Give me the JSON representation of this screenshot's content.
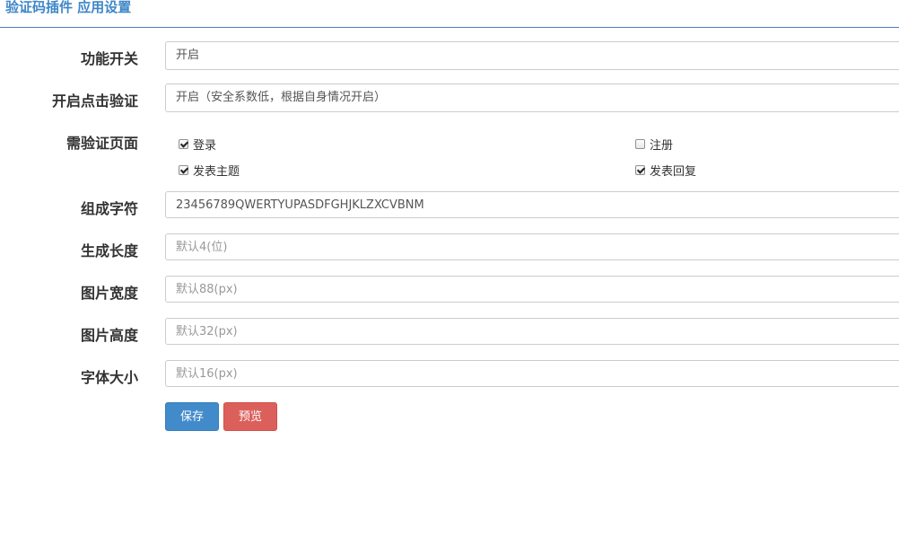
{
  "header": {
    "title": "验证码插件 应用设置"
  },
  "form": {
    "enable": {
      "label": "功能开关",
      "value": "开启"
    },
    "click_verify": {
      "label": "开启点击验证",
      "value": "开启（安全系数低，根据自身情况开启）"
    },
    "pages": {
      "label": "需验证页面",
      "options": [
        {
          "label": "登录",
          "checked": true
        },
        {
          "label": "注册",
          "checked": false
        },
        {
          "label": "发表主题",
          "checked": true
        },
        {
          "label": "发表回复",
          "checked": true
        }
      ]
    },
    "charset": {
      "label": "组成字符",
      "value": "23456789QWERTYUPASDFGHJKLZXCVBNM",
      "placeholder": ""
    },
    "length": {
      "label": "生成长度",
      "value": "",
      "placeholder": "默认4(位)"
    },
    "width": {
      "label": "图片宽度",
      "value": "",
      "placeholder": "默认88(px)"
    },
    "height": {
      "label": "图片高度",
      "value": "",
      "placeholder": "默认32(px)"
    },
    "font_size": {
      "label": "字体大小",
      "value": "",
      "placeholder": "默认16(px)"
    }
  },
  "buttons": {
    "save_label": "保存",
    "preview_label": "预览"
  },
  "colors": {
    "header_title": "#3e86c8",
    "save_button": "#428bca",
    "preview_button": "#d9534f"
  }
}
